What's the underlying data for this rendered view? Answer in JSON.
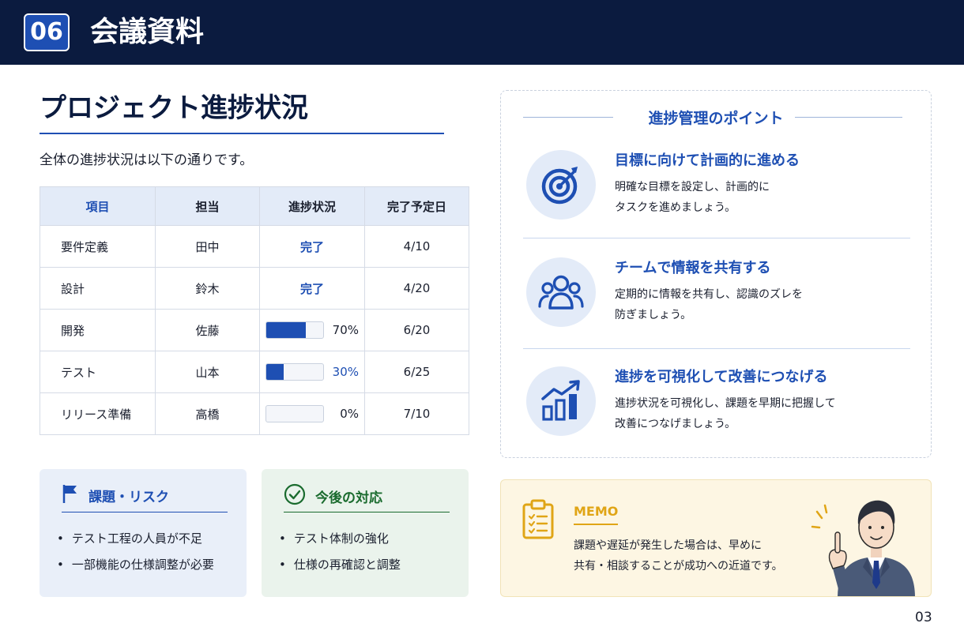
{
  "header": {
    "section_number": "06",
    "section_title": "会議資料"
  },
  "main": {
    "title": "プロジェクト進捗状況",
    "intro": "全体の進捗状況は以下の通りです。"
  },
  "table": {
    "headers": [
      "項目",
      "担当",
      "進捗状況",
      "完了予定日"
    ],
    "rows": [
      {
        "item": "要件定義",
        "owner": "田中",
        "status": "完了",
        "due": "4/10"
      },
      {
        "item": "設計",
        "owner": "鈴木",
        "status": "完了",
        "due": "4/20"
      },
      {
        "item": "開発",
        "owner": "佐藤",
        "progress": 0.7,
        "progress_label": "70%",
        "due": "6/20"
      },
      {
        "item": "テスト",
        "owner": "山本",
        "progress": 0.3,
        "progress_label": "30%",
        "due": "6/25"
      },
      {
        "item": "リリース準備",
        "owner": "高橋",
        "progress": 0,
        "progress_label": "0%",
        "due": "7/10"
      }
    ]
  },
  "issues": {
    "title": "課題・リスク",
    "items": [
      "テスト工程の人員が不足",
      "一部機能の仕様調整が必要"
    ]
  },
  "actions": {
    "title": "今後の対応",
    "items": [
      "テスト体制の強化",
      "仕様の再確認と調整"
    ]
  },
  "points": {
    "title": "進捗管理のポイント",
    "items": [
      {
        "icon": "target-icon",
        "title": "目標に向けて計画的に進める",
        "desc_line1": "明確な目標を設定し、計画的に",
        "desc_line2": "タスクを進めましょう。"
      },
      {
        "icon": "team-icon",
        "title": "チームで情報を共有する",
        "desc_line1": "定期的に情報を共有し、認識のズレを",
        "desc_line2": "防ぎましょう。"
      },
      {
        "icon": "growth-chart-icon",
        "title": "進捗を可視化して改善につなげる",
        "desc_line1": "進捗状況を可視化し、課題を早期に把握して",
        "desc_line2": "改善につなげましょう。"
      }
    ]
  },
  "memo": {
    "label": "MEMO",
    "line1": "課題や遅延が発生した場合は、早めに",
    "line2": "共有・相談することが成功への近道です。"
  },
  "page_number": "03",
  "colors": {
    "navy": "#0b1b3f",
    "accent_blue": "#1e4fb3",
    "green": "#1a6b2e",
    "memo_yellow": "#e0a516"
  }
}
